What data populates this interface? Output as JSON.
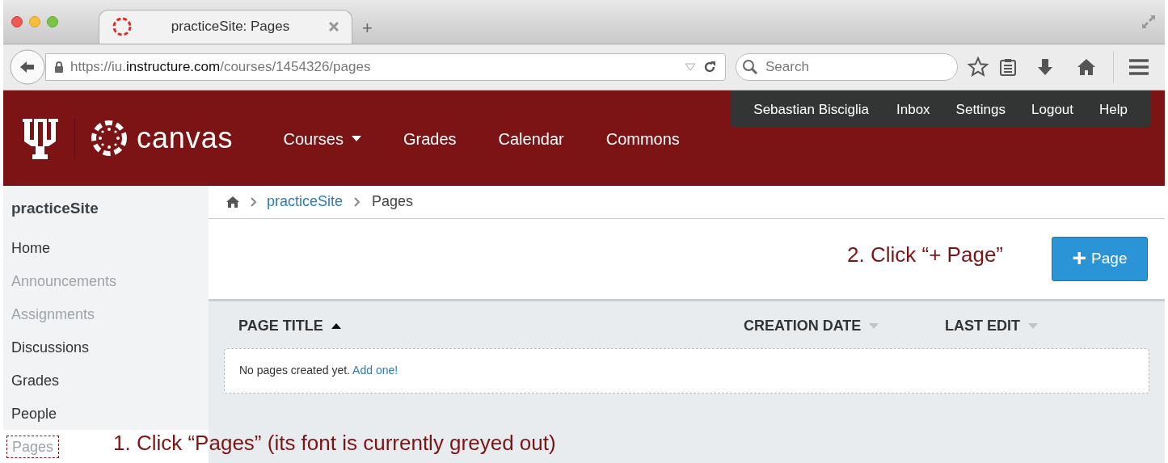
{
  "browser": {
    "tab_title": "practiceSite: Pages",
    "new_tab": "+",
    "url": {
      "prefix": "https://iu.",
      "domain": "instructure.com",
      "path": "/courses/1454326/pages"
    },
    "search": {
      "placeholder": "Search"
    }
  },
  "header": {
    "logo_text": "canvas",
    "nav": [
      {
        "label": "Courses",
        "dropdown": true
      },
      {
        "label": "Grades",
        "dropdown": false
      },
      {
        "label": "Calendar",
        "dropdown": false
      },
      {
        "label": "Commons",
        "dropdown": false
      }
    ],
    "user_menu": [
      "Sebastian Bisciglia",
      "Inbox",
      "Settings",
      "Logout",
      "Help"
    ]
  },
  "sidebar": {
    "title": "practiceSite",
    "items": [
      {
        "label": "Home",
        "disabled": false,
        "highlighted": false
      },
      {
        "label": "Announcements",
        "disabled": true,
        "highlighted": false
      },
      {
        "label": "Assignments",
        "disabled": true,
        "highlighted": false
      },
      {
        "label": "Discussions",
        "disabled": false,
        "highlighted": false
      },
      {
        "label": "Grades",
        "disabled": false,
        "highlighted": false
      },
      {
        "label": "People",
        "disabled": false,
        "highlighted": false
      },
      {
        "label": "Pages",
        "disabled": true,
        "highlighted": true
      }
    ]
  },
  "breadcrumb": {
    "link": "practiceSite",
    "current": "Pages"
  },
  "add_button": {
    "icon": "+",
    "label": "Page"
  },
  "table": {
    "columns": [
      {
        "label": "PAGE TITLE",
        "sorted": true
      },
      {
        "label": "CREATION DATE",
        "sorted": false
      },
      {
        "label": "LAST EDIT",
        "sorted": false
      }
    ],
    "empty_text": "No pages created yet.",
    "empty_link": "Add one!"
  },
  "annotations": [
    "1. Click “Pages” (its font is currently greyed out)",
    "2. Click “+ Page”"
  ]
}
